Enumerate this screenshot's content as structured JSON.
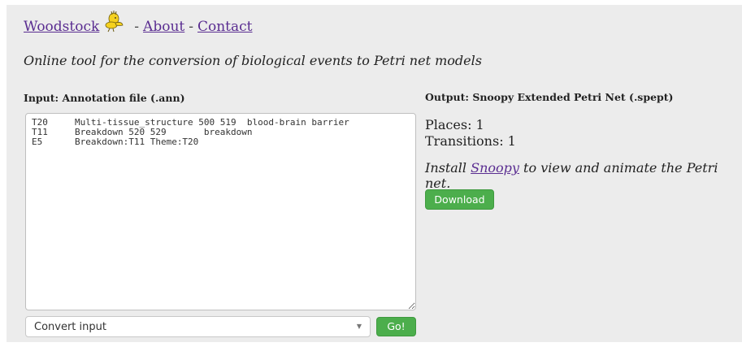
{
  "nav": {
    "home_label": "Woodstock",
    "about_label": "About",
    "contact_label": "Contact",
    "separator": "-"
  },
  "tagline": "Online tool for the conversion of biological events to Petri net models",
  "input": {
    "heading": "Input: Annotation file (.ann)",
    "content": "T20\tMulti-tissue_structure 500 519\tblood-brain barrier\nT11\tBreakdown 520 529\tbreakdown\nE5\tBreakdown:T11 Theme:T20",
    "select_value": "Convert input",
    "go_label": "Go!"
  },
  "output": {
    "heading": "Output: Snoopy Extended Petri Net (.spept)",
    "places": "Places: 1",
    "transitions": "Transitions: 1",
    "install_prefix": "Install",
    "snoopy_link": "Snoopy",
    "install_suffix": "to view and animate the Petri net.",
    "download_label": "Download"
  },
  "colors": {
    "link": "#5a2d91",
    "button_green": "#4cae4c",
    "panel_bg": "#ececec"
  },
  "icons": {
    "logo": "woodstock-bird-icon",
    "select_caret": "caret-down-icon"
  }
}
